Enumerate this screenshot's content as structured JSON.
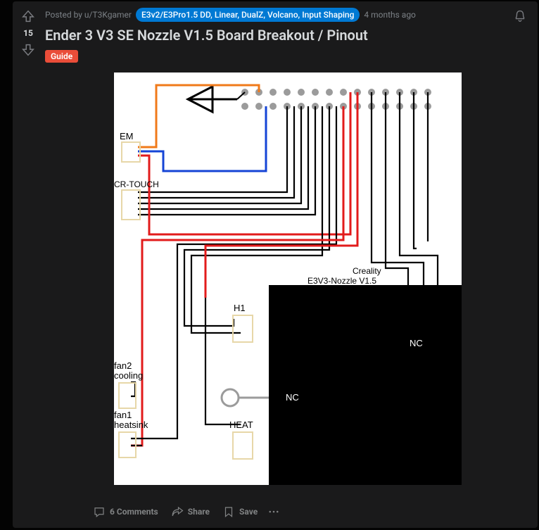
{
  "post": {
    "posted_by_prefix": "Posted by ",
    "author_prefix": "u/",
    "author": "T3Kgamer",
    "user_flair": "E3v2/E3Pro1.5 DD, Linear, DualZ, Volcano, Input Shaping",
    "time": "4 months ago",
    "title": "Ender 3 V3 SE Nozzle V1.5 Board Breakout / Pinout",
    "flair": "Guide",
    "score": "15"
  },
  "actions": {
    "comments": "6 Comments",
    "share": "Share",
    "save": "Save"
  },
  "diagram": {
    "labels": {
      "em": "EM",
      "crtouch": "CR-TOUCH",
      "h1": "H1",
      "fan2a": "fan2",
      "fan2b": "cooling",
      "fan1a": "fan1",
      "fan1b": "heatsink",
      "heat": "HEAT",
      "nc1": "NC",
      "nc2": "NC",
      "board1": "Creality",
      "board2": "E3V3-Nozzle V1.5"
    }
  }
}
